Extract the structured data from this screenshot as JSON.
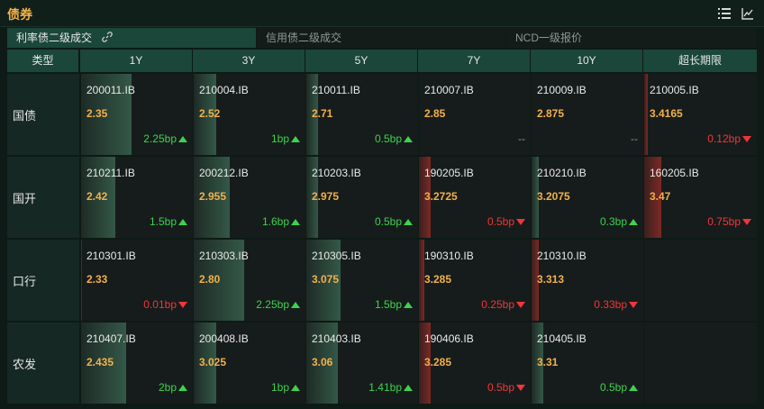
{
  "header": {
    "title": "债券",
    "list_icon": "list-icon",
    "chart_icon": "line-chart-icon"
  },
  "tabs": [
    {
      "label": "利率债二级成交",
      "active": true
    },
    {
      "label": "信用债二级成交",
      "active": false
    },
    {
      "label": "NCD一级报价",
      "active": false
    }
  ],
  "columns": [
    "类型",
    "1Y",
    "3Y",
    "5Y",
    "7Y",
    "10Y",
    "超长期限"
  ],
  "colors": {
    "up": "#3fd24f",
    "down": "#f0363b",
    "yield": "#f4b04a",
    "accent": "#f5b54a"
  },
  "rows": [
    {
      "label": "国债",
      "cells": [
        {
          "code": "200011.IB",
          "yield": "2.35",
          "change": "2.25bp",
          "dir": "up",
          "bar_pct": 45
        },
        {
          "code": "210004.IB",
          "yield": "2.52",
          "change": "1bp",
          "dir": "up",
          "bar_pct": 20
        },
        {
          "code": "210011.IB",
          "yield": "2.71",
          "change": "0.5bp",
          "dir": "up",
          "bar_pct": 10
        },
        {
          "code": "210007.IB",
          "yield": "2.85",
          "change": "--",
          "dir": "flat",
          "bar_pct": 0
        },
        {
          "code": "210009.IB",
          "yield": "2.875",
          "change": "--",
          "dir": "flat",
          "bar_pct": 0
        },
        {
          "code": "210005.IB",
          "yield": "3.4165",
          "change": "0.12bp",
          "dir": "down",
          "bar_pct": 3
        }
      ]
    },
    {
      "label": "国开",
      "cells": [
        {
          "code": "210211.IB",
          "yield": "2.42",
          "change": "1.5bp",
          "dir": "up",
          "bar_pct": 30
        },
        {
          "code": "200212.IB",
          "yield": "2.955",
          "change": "1.6bp",
          "dir": "up",
          "bar_pct": 32
        },
        {
          "code": "210203.IB",
          "yield": "2.975",
          "change": "0.5bp",
          "dir": "up",
          "bar_pct": 10
        },
        {
          "code": "190205.IB",
          "yield": "3.2725",
          "change": "0.5bp",
          "dir": "down",
          "bar_pct": 10
        },
        {
          "code": "210210.IB",
          "yield": "3.2075",
          "change": "0.3bp",
          "dir": "up",
          "bar_pct": 6
        },
        {
          "code": "160205.IB",
          "yield": "3.47",
          "change": "0.75bp",
          "dir": "down",
          "bar_pct": 15
        }
      ]
    },
    {
      "label": "口行",
      "cells": [
        {
          "code": "210301.IB",
          "yield": "2.33",
          "change": "0.01bp",
          "dir": "down",
          "bar_pct": 1
        },
        {
          "code": "210303.IB",
          "yield": "2.80",
          "change": "2.25bp",
          "dir": "up",
          "bar_pct": 45
        },
        {
          "code": "210305.IB",
          "yield": "3.075",
          "change": "1.5bp",
          "dir": "up",
          "bar_pct": 30
        },
        {
          "code": "190310.IB",
          "yield": "3.285",
          "change": "0.25bp",
          "dir": "down",
          "bar_pct": 5
        },
        {
          "code": "210310.IB",
          "yield": "3.313",
          "change": "0.33bp",
          "dir": "down",
          "bar_pct": 6
        },
        null
      ]
    },
    {
      "label": "农发",
      "cells": [
        {
          "code": "210407.IB",
          "yield": "2.435",
          "change": "2bp",
          "dir": "up",
          "bar_pct": 40
        },
        {
          "code": "200408.IB",
          "yield": "3.025",
          "change": "1bp",
          "dir": "up",
          "bar_pct": 20
        },
        {
          "code": "210403.IB",
          "yield": "3.06",
          "change": "1.41bp",
          "dir": "up",
          "bar_pct": 28
        },
        {
          "code": "190406.IB",
          "yield": "3.285",
          "change": "0.5bp",
          "dir": "down",
          "bar_pct": 10
        },
        {
          "code": "210405.IB",
          "yield": "3.31",
          "change": "0.5bp",
          "dir": "up",
          "bar_pct": 10
        },
        null
      ]
    }
  ]
}
